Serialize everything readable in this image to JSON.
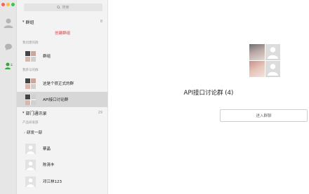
{
  "search": {
    "placeholder": "搜索"
  },
  "groups": {
    "title": "群组",
    "count": "8",
    "create_label": "创建群组",
    "created_label": "我创建的群",
    "created": [
      {
        "name": "群组"
      }
    ],
    "joined_label": "我参与的群",
    "joined": [
      {
        "name": "这是个很正式的群"
      },
      {
        "name": "API接口讨论群"
      }
    ]
  },
  "directory": {
    "title": "部门通讯录",
    "count": "29",
    "org_label": "产品研发部",
    "dept": "研发一部",
    "members": [
      {
        "name": "蔡晶"
      },
      {
        "name": "陈清丰"
      },
      {
        "name": "邓江林123"
      }
    ]
  },
  "detail": {
    "group_name": "API接口讨论群 (4)",
    "enter_button": "进入群聊"
  },
  "colors": {
    "accent": "#e0383e",
    "contacts_active": "#37a63c"
  }
}
